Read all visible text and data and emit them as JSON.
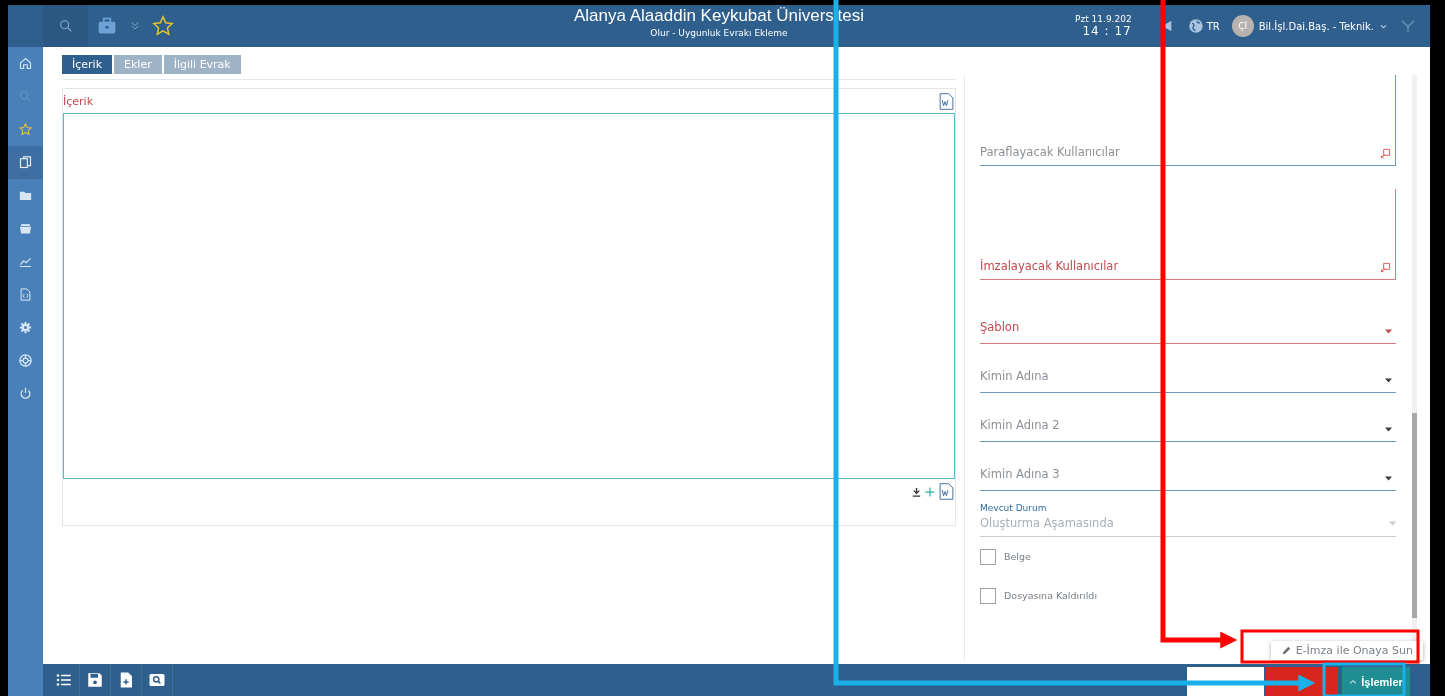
{
  "header": {
    "title": "Alanya Alaaddin Keykubat Üniversitesi",
    "subtitle": "Olur - Uygunluk Evrakı Ekleme",
    "date": "Pzt 11.9.202",
    "time": "14 : 17",
    "language": "TR",
    "user_initials": "Çİ",
    "user_role": "Bil.İşl.Dai.Baş. - Teknik."
  },
  "sidebar": {
    "items": [
      {
        "selected": false
      },
      {
        "selected": false
      },
      {
        "selected": false
      },
      {
        "selected": true
      },
      {
        "selected": false
      },
      {
        "selected": false
      },
      {
        "selected": false
      },
      {
        "selected": false
      },
      {
        "selected": false
      },
      {
        "selected": false
      },
      {
        "selected": false
      }
    ]
  },
  "tabs": [
    {
      "label": "İçerik",
      "selected": true
    },
    {
      "label": "Ekler",
      "selected": false
    },
    {
      "label": "İlgili Evrak",
      "selected": false
    }
  ],
  "content": {
    "label": "İçerik"
  },
  "fields": [
    {
      "kind": "userlist",
      "label": "Paraflayacak Kullanıcılar",
      "required": false
    },
    {
      "kind": "userlist",
      "label": "İmzalayacak Kullanıcılar",
      "required": true
    },
    {
      "kind": "dropdown",
      "label": "Şablon",
      "required": true
    },
    {
      "kind": "dropdown",
      "label": "Kimin Adına",
      "required": false
    },
    {
      "kind": "dropdown",
      "label": "Kimin Adına 2",
      "required": false
    },
    {
      "kind": "dropdown",
      "label": "Kimin Adına 3",
      "required": false
    },
    {
      "kind": "status",
      "label": "Mevcut Durum",
      "value": "Oluşturma Aşamasında",
      "disabled": true
    },
    {
      "kind": "checkbox",
      "label": "Belge",
      "checked": false
    },
    {
      "kind": "checkbox",
      "label": "Dosyasına Kaldırıldı",
      "checked": false
    }
  ],
  "actions_menu": {
    "items": [
      "E-İmza ile Onaya Sun"
    ]
  },
  "footer_buttons": [
    {
      "kind": "plain"
    },
    {
      "kind": "danger"
    },
    {
      "kind": "primary",
      "label": "İşlemler"
    }
  ],
  "annotations": [
    {
      "color": "#ff0000"
    },
    {
      "color": "#1ab0ea"
    }
  ]
}
